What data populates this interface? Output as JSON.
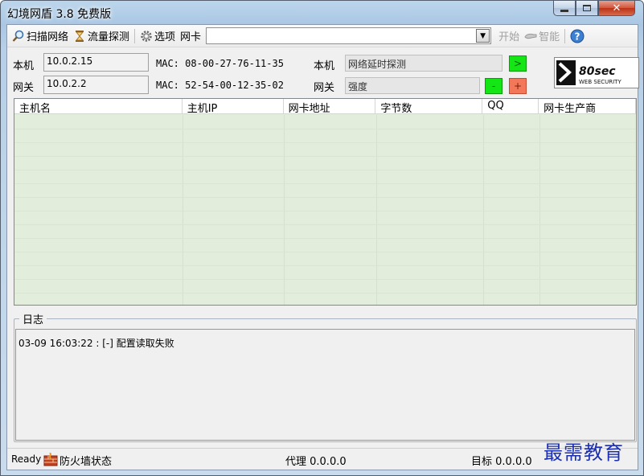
{
  "window": {
    "title": "幻境网盾 3.8 免费版",
    "controls": {
      "minimize": "▭",
      "maximize": "□",
      "close": "✕"
    }
  },
  "toolbar": {
    "scan_label": "扫描网络",
    "flow_label": "流量探测",
    "options_label": "选项",
    "nic_label": "网卡",
    "nic_value": "",
    "start_label": "开始",
    "smart_label": "智能",
    "help_label": "?"
  },
  "local": {
    "label": "本机",
    "ip": "10.0.2.15",
    "mac": "MAC: 08-00-27-76-11-35",
    "probe_label": "本机",
    "probe_value": "网络延时探测",
    "probe_button": ">"
  },
  "gateway": {
    "label": "网关",
    "ip": "10.0.2.2",
    "mac": "MAC: 52-54-00-12-35-02",
    "strength_label": "网关",
    "strength_value": "强度",
    "minus_button": "-",
    "plus_button": "+"
  },
  "logo": {
    "text": "80sec",
    "subtext": "WEB SECURITY"
  },
  "table": {
    "columns": [
      "主机名",
      "主机IP",
      "网卡地址",
      "字节数",
      "QQ",
      "网卡生产商"
    ],
    "rows": []
  },
  "log": {
    "title": "日志",
    "entries": [
      "03-09 16:03:22 : [-] 配置读取失败"
    ]
  },
  "status": {
    "ready": "Ready",
    "firewall_label": "防火墙状态",
    "proxy": "代理 0.0.0.0",
    "target": "目标 0.0.0.0"
  },
  "watermark": "最需教育",
  "colors": {
    "grid_bg": "#e2eedb",
    "go_green": "#14e514",
    "plus_orange": "#f3785a",
    "watermark_blue": "#1b2fb0"
  }
}
